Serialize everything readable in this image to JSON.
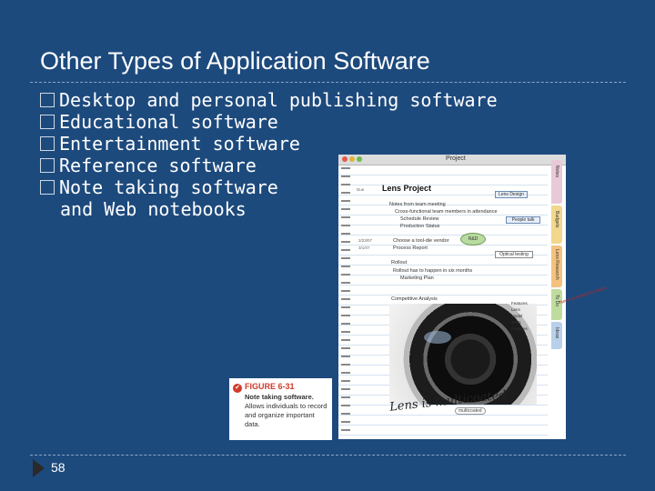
{
  "slide": {
    "title": "Other Types of Application Software",
    "page_number": "58"
  },
  "bullets": [
    {
      "text": "Desktop and personal publishing software"
    },
    {
      "text": "Educational software"
    },
    {
      "text": "Entertainment software"
    },
    {
      "text": "Reference software"
    },
    {
      "text": "Note taking software",
      "continuation": "and Web notebooks"
    }
  ],
  "figure": {
    "number": "FIGURE 6-31",
    "caption_bold": "Note taking software.",
    "caption_rest": "Allows individuals to record and organize important data."
  },
  "screenshot": {
    "window_title": "Project",
    "page_title": "Lens Project",
    "margin_label": "Due",
    "notes": [
      "Notes from team meeting",
      "Cross-functional team members in attendance",
      "Schedule Review",
      "Production Status",
      "Choose a tool-die vendor",
      "Process Report",
      "Rollout",
      "Rollout has to happen in six months",
      "Marketing Plan",
      "Competitive Analysis"
    ],
    "margin_dates": [
      "2/23/07",
      "3/1/07"
    ],
    "callouts": {
      "lens_design": "Lens Design",
      "people": "People talk",
      "rd": "R&D",
      "optical": "Optical testing"
    },
    "feature_box": [
      "Features",
      "Lens",
      "Model",
      "ZTRL",
      "Features"
    ],
    "tabs": [
      "Notes",
      "Budgets",
      "Lens Research",
      "To Do",
      "Ideas"
    ],
    "sticky_note": "Need to make this faster",
    "handwriting": "Lens is multicoated",
    "handwriting_tag": "multicoated"
  },
  "colors": {
    "background": "#1d4a7d",
    "text": "#ffffff",
    "figure_accent": "#d23a2a"
  }
}
